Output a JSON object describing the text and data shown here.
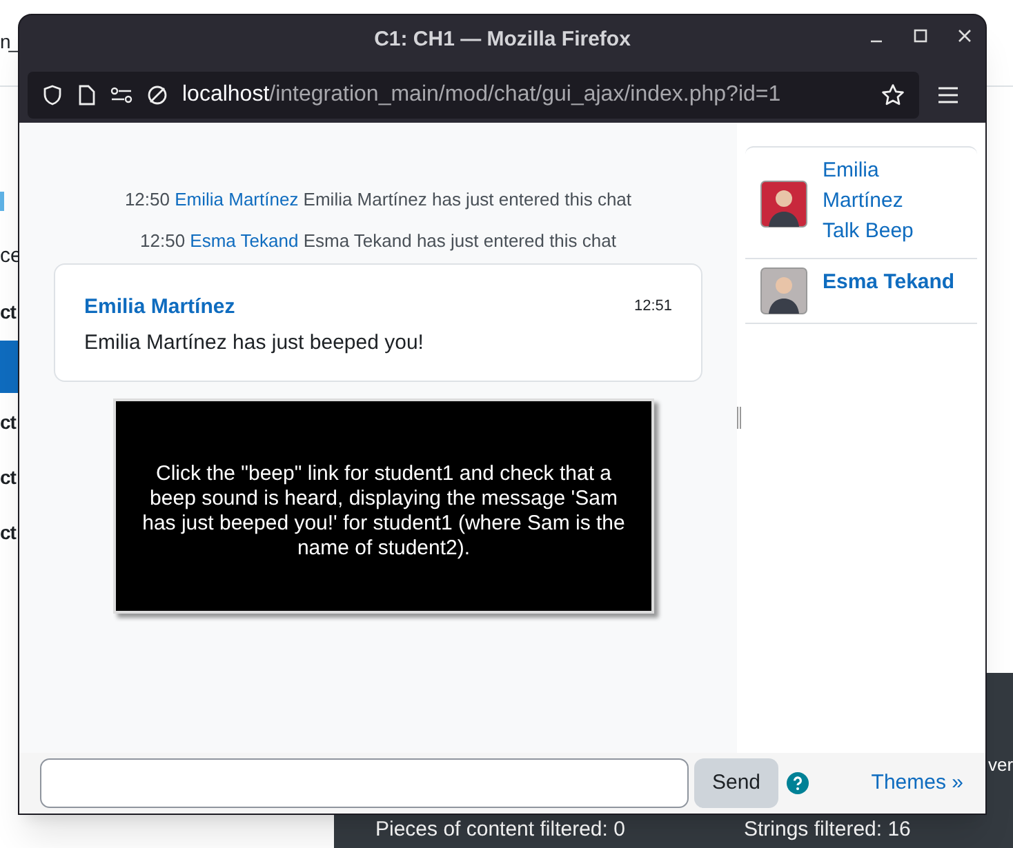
{
  "background": {
    "header_fragment": "n_",
    "sidebar_fragments": [
      {
        "kind": "marker"
      },
      {
        "kind": "text",
        "text": "ce"
      },
      {
        "kind": "heading",
        "text": "ct"
      },
      {
        "kind": "active"
      },
      {
        "kind": "heading",
        "text": "ct"
      },
      {
        "kind": "heading",
        "text": "ct"
      },
      {
        "kind": "heading",
        "text": "ct"
      }
    ],
    "footer": {
      "fragment": "ver",
      "items": [
        "Pieces of content filtered: 0",
        "Strings filtered: 16"
      ]
    }
  },
  "window": {
    "title": "C1: CH1 — Mozilla Firefox",
    "url": {
      "host": "localhost",
      "path": "/integration_main/mod/chat/gui_ajax/index.php?id=1"
    },
    "messages": [
      {
        "kind": "system",
        "time": "12:50",
        "user": "Emilia Martínez",
        "text": "Emilia Martínez has just entered this chat"
      },
      {
        "kind": "system",
        "time": "12:50",
        "user": "Esma Tekand",
        "text": "Esma Tekand has just entered this chat"
      },
      {
        "kind": "card",
        "time": "12:51",
        "user": "Emilia Martínez",
        "text": "Emilia Martínez has just beeped you!"
      }
    ],
    "overlay": "Click the \"beep\" link for student1 and check that a beep sound is heard, displaying the message 'Sam has just beeped you!' for student1 (where Sam is the name of student2).",
    "users": [
      {
        "kind": "other",
        "name_lines": [
          "Emilia",
          "Martínez"
        ],
        "action": "Talk Beep",
        "color": "#c8283c"
      },
      {
        "kind": "self",
        "name_lines": [
          "Esma Tekand"
        ],
        "color": "#b9b4b4"
      }
    ],
    "send_button": "Send",
    "themes_link": "Themes »"
  }
}
